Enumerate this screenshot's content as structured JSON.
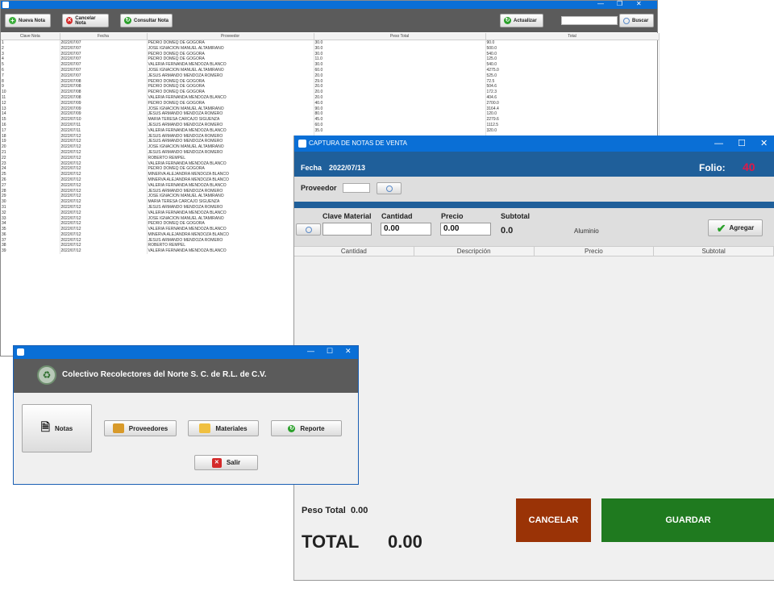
{
  "list_window": {
    "toolbar": {
      "nueva": "Nueva Nota",
      "cancelar": "Cancelar Nota",
      "consultar": "Consultar Nota",
      "actualizar": "Actualizar",
      "buscar": "Buscar"
    },
    "columns": [
      "Clave Nota",
      "Fecha",
      "Proveedor",
      "Peso Total",
      "Total"
    ],
    "rows": [
      [
        "1",
        "2022/07/07",
        "PEDRO DOMEQ DE GOGORA",
        "30.0",
        "90.0"
      ],
      [
        "2",
        "2022/07/07",
        "JOSE IGNACION MANUEL ALTAMIRANO",
        "30.0",
        "500.0"
      ],
      [
        "3",
        "2022/07/07",
        "PEDRO DOMEQ DE GOGORA",
        "30.0",
        "540.0"
      ],
      [
        "4",
        "2022/07/07",
        "PEDRO DOMEQ DE GOGORA",
        "11.0",
        "125.0"
      ],
      [
        "5",
        "2022/07/07",
        "VALERIA FERNANDA MENDOZA BLANCO",
        "30.0",
        "540.0"
      ],
      [
        "6",
        "2022/07/07",
        "JOSE IGNACION MANUEL ALTAMIRANO",
        "60.0",
        "4275.0"
      ],
      [
        "7",
        "2022/07/07",
        "JESUS ARMANDO MENDOZA ROMERO",
        "20.0",
        "525.0"
      ],
      [
        "8",
        "2022/07/08",
        "PEDRO DOMEQ DE GOGORA",
        "29.0",
        "72.5"
      ],
      [
        "9",
        "2022/07/08",
        "PEDRO DOMEQ DE GOGORA",
        "20.0",
        "504.6"
      ],
      [
        "10",
        "2022/07/08",
        "PEDRO DOMEQ DE GOGORA",
        "20.0",
        "172.3"
      ],
      [
        "11",
        "2022/07/08",
        "VALERIA FERNANDA MENDOZA BLANCO",
        "20.0",
        "404.6"
      ],
      [
        "12",
        "2022/07/09",
        "PEDRO DOMEQ DE GOGORA",
        "40.0",
        "2700.0"
      ],
      [
        "13",
        "2022/07/09",
        "JOSE IGNACION MANUEL ALTAMIRANO",
        "90.0",
        "3164.4"
      ],
      [
        "14",
        "2022/07/09",
        "JESUS ARMANDO MENDOZA ROMERO",
        "80.0",
        "120.0"
      ],
      [
        "15",
        "2022/07/10",
        "MARIA TERESA CARCAJO SIGUENZA",
        "45.0",
        "2279.6"
      ],
      [
        "16",
        "2022/07/11",
        "JESUS ARMANDO MENDOZA ROMERO",
        "60.0",
        "1112.5"
      ],
      [
        "17",
        "2022/07/11",
        "VALERIA FERNANDA MENDOZA BLANCO",
        "35.0",
        "320.0"
      ],
      [
        "18",
        "2022/07/12",
        "JESUS ARMANDO MENDOZA ROMERO",
        "",
        ""
      ],
      [
        "19",
        "2022/07/12",
        "JESUS ARMANDO MENDOZA ROMERO",
        "",
        ""
      ],
      [
        "20",
        "2022/07/12",
        "JOSE IGNACION MANUEL ALTAMIRANO",
        "",
        ""
      ],
      [
        "21",
        "2022/07/12",
        "JESUS ARMANDO MENDOZA ROMERO",
        "",
        ""
      ],
      [
        "22",
        "2022/07/12",
        "ROBERTO REMPEL",
        "",
        ""
      ],
      [
        "23",
        "2022/07/12",
        "VALERIA FERNANDA MENDOZA BLANCO",
        "",
        ""
      ],
      [
        "24",
        "2022/07/12",
        "PEDRO DOMEQ DE GOGORA",
        "",
        ""
      ],
      [
        "25",
        "2022/07/12",
        "MINERVA ALEJANDRA MENDOZA BLANCO",
        "",
        ""
      ],
      [
        "26",
        "2022/07/12",
        "MINERVA ALEJANDRA MENDOZA BLANCO",
        "",
        ""
      ],
      [
        "27",
        "2022/07/12",
        "VALERIA FERNANDA MENDOZA BLANCO",
        "",
        ""
      ],
      [
        "28",
        "2022/07/12",
        "JESUS ARMANDO MENDOZA ROMERO",
        "",
        ""
      ],
      [
        "29",
        "2022/07/12",
        "JOSE IGNACION MANUEL ALTAMIRANO",
        "",
        ""
      ],
      [
        "30",
        "2022/07/12",
        "MARIA TERESA CARCAJO SIGUENZA",
        "",
        ""
      ],
      [
        "31",
        "2022/07/12",
        "JESUS ARMANDO MENDOZA ROMERO",
        "",
        ""
      ],
      [
        "32",
        "2022/07/12",
        "VALERIA FERNANDA MENDOZA BLANCO",
        "",
        ""
      ],
      [
        "33",
        "2022/07/12",
        "JOSE IGNACION MANUEL ALTAMIRANO",
        "",
        ""
      ],
      [
        "34",
        "2022/07/12",
        "PEDRO DOMEQ DE GOGORA",
        "",
        ""
      ],
      [
        "35",
        "2022/07/12",
        "VALERIA FERNANDA MENDOZA BLANCO",
        "",
        ""
      ],
      [
        "36",
        "2022/07/12",
        "MINERVA ALEJANDRA MENDOZA BLANCO",
        "",
        ""
      ],
      [
        "37",
        "2022/07/12",
        "JESUS ARMANDO MENDOZA ROMERO",
        "",
        ""
      ],
      [
        "38",
        "2022/07/12",
        "ROBERTO REMPEL",
        "",
        ""
      ],
      [
        "39",
        "2022/07/12",
        "VALERIA FERNANDA MENDOZA BLANCO",
        "",
        ""
      ]
    ]
  },
  "capture_window": {
    "title": "CAPTURA DE NOTAS DE VENTA",
    "fecha_label": "Fecha",
    "fecha_value": "2022/07/13",
    "folio_label": "Folio:",
    "folio_value": "40",
    "proveedor_label": "Proveedor",
    "clave_label": "Clave Material",
    "cantidad_label": "Cantidad",
    "cantidad_value": "0.00",
    "precio_label": "Precio",
    "precio_value": "0.00",
    "subtotal_label": "Subtotal",
    "subtotal_value": "0.0",
    "material_name": "Aluminio",
    "agregar_label": "Agregar",
    "table_columns": [
      "Cantidad",
      "Descripción",
      "Precio",
      "Subtotal"
    ],
    "peso_total_label": "Peso Total",
    "peso_total_value": "0.00",
    "total_label": "TOTAL",
    "total_value": "0.00",
    "cancel_label": "CANCELAR",
    "save_label": "GUARDAR",
    "colors": {
      "header": "#1f5f9a",
      "folio": "#e01848",
      "cancel": "#9a3306",
      "save": "#1f7a1f"
    }
  },
  "main_window": {
    "company": "Colectivo Recolectores del Norte S. C. de R.L. de C.V.",
    "buttons": {
      "notas": "Notas",
      "proveedores": "Proveedores",
      "materiales": "Materiales",
      "reporte": "Reporte",
      "salir": "Salir"
    }
  }
}
